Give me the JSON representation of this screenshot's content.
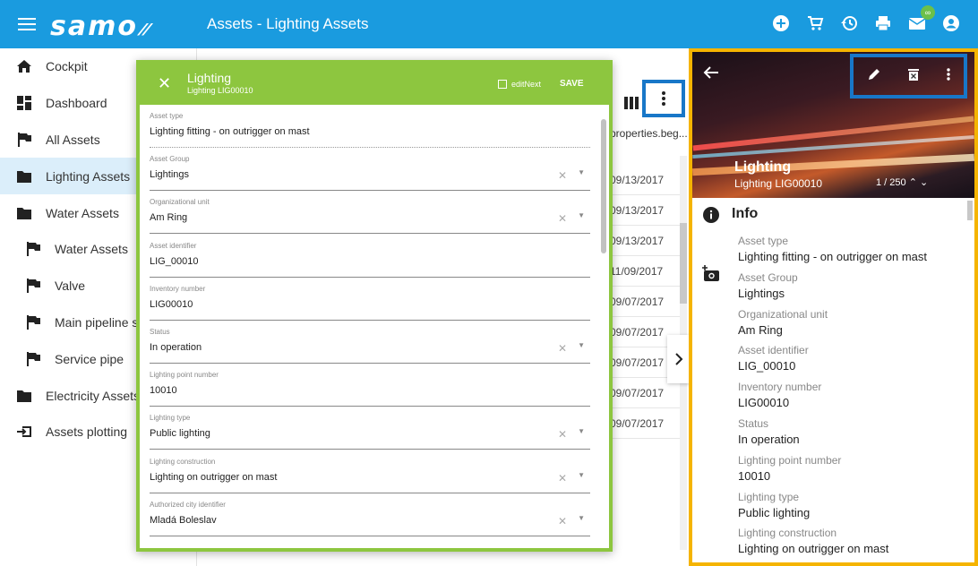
{
  "header": {
    "logo": "samo",
    "title": "Assets - Lighting Assets",
    "mail_badge": "∞"
  },
  "sidebar": {
    "items": [
      {
        "label": "Cockpit",
        "icon": "home-icon"
      },
      {
        "label": "Dashboard",
        "icon": "dashboard-icon"
      },
      {
        "label": "All Assets",
        "icon": "flag-icon"
      },
      {
        "label": "Lighting Assets",
        "icon": "folder-icon",
        "active": true
      },
      {
        "label": "Water Assets",
        "icon": "folder-icon"
      },
      {
        "label": "Water Assets",
        "icon": "flag-icon",
        "sub": true
      },
      {
        "label": "Valve",
        "icon": "flag-icon",
        "sub": true
      },
      {
        "label": "Main pipeline se",
        "icon": "flag-icon",
        "sub": true
      },
      {
        "label": "Service pipe",
        "icon": "flag-icon",
        "sub": true
      },
      {
        "label": "Electricity Assets",
        "icon": "folder-icon"
      },
      {
        "label": "Assets plotting",
        "icon": "input-icon"
      }
    ]
  },
  "table": {
    "column_header": "properties.beg...",
    "rows": [
      "09/13/2017",
      "09/13/2017",
      "09/13/2017",
      "11/09/2017",
      "09/07/2017",
      "09/07/2017",
      "09/07/2017",
      "09/07/2017",
      "09/07/2017"
    ]
  },
  "dialog": {
    "title": "Lighting",
    "subtitle": "Lighting LIG00010",
    "edit_next_label": "editNext",
    "save_label": "SAVE",
    "fields": [
      {
        "label": "Asset type",
        "value": "Lighting fitting - on outrigger on mast",
        "select": false
      },
      {
        "label": "Asset Group",
        "value": "Lightings",
        "select": true
      },
      {
        "label": "Organizational unit",
        "value": "Am Ring",
        "select": true
      },
      {
        "label": "Asset identifier",
        "value": "LIG_00010",
        "select": false
      },
      {
        "label": "Inventory number",
        "value": "LIG00010",
        "select": false
      },
      {
        "label": "Status",
        "value": "In operation",
        "select": true
      },
      {
        "label": "Lighting point number",
        "value": "10010",
        "select": false
      },
      {
        "label": "Lighting type",
        "value": "Public lighting",
        "select": true
      },
      {
        "label": "Lighting construction",
        "value": "Lighting on outrigger on mast",
        "select": true
      },
      {
        "label": "Authorized city identifier",
        "value": "Mladá Boleslav",
        "select": true
      }
    ]
  },
  "detail": {
    "title": "Lighting",
    "subtitle": "Lighting LIG00010",
    "pager": "1 / 250",
    "section_title": "Info",
    "items": [
      {
        "label": "Asset type",
        "value": "Lighting fitting - on outrigger on mast"
      },
      {
        "label": "Asset Group",
        "value": "Lightings"
      },
      {
        "label": "Organizational unit",
        "value": "Am Ring"
      },
      {
        "label": "Asset identifier",
        "value": "LIG_00010"
      },
      {
        "label": "Inventory number",
        "value": "LIG00010"
      },
      {
        "label": "Status",
        "value": "In operation"
      },
      {
        "label": "Lighting point number",
        "value": "10010"
      },
      {
        "label": "Lighting type",
        "value": "Public lighting"
      },
      {
        "label": "Lighting construction",
        "value": "Lighting on outrigger on mast"
      }
    ]
  },
  "colors": {
    "primary": "#1a9bdf",
    "dialog_accent": "#8dc63f",
    "highlight_blue": "#1877c8",
    "highlight_yellow": "#f5b400",
    "active_row": "#dbeefa"
  }
}
